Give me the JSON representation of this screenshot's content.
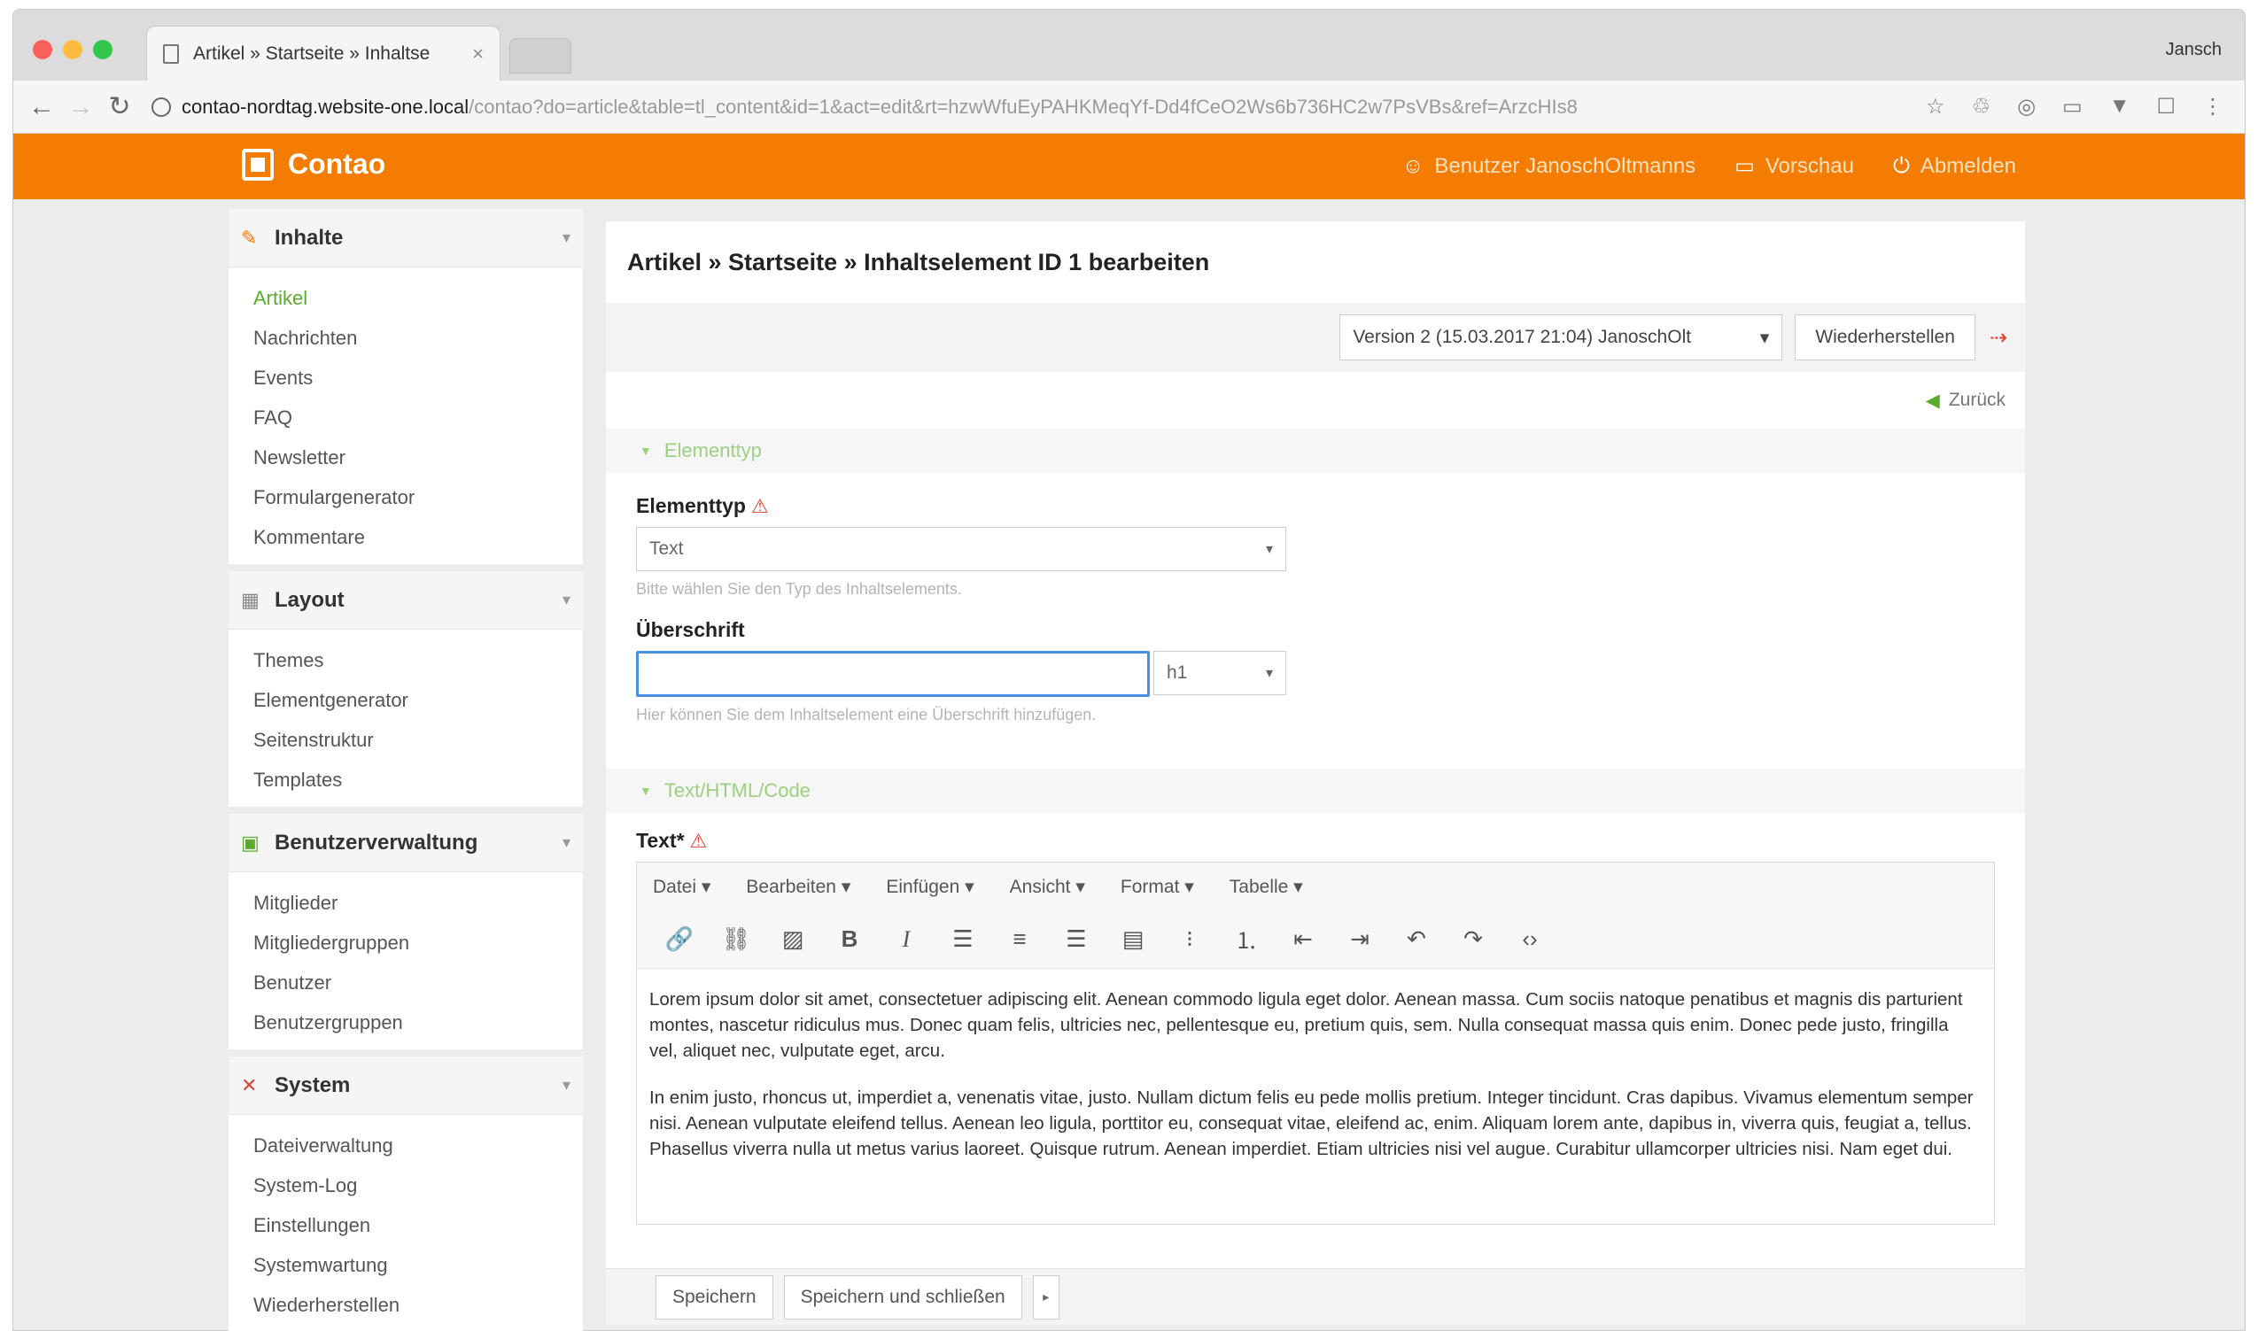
{
  "browser": {
    "tab_title": "Artikel » Startseite » Inhaltse",
    "tab_close": "×",
    "profile_name": "Jansch",
    "url_host": "contao-nordtag.website-one.local",
    "url_path": "/contao?do=article&table=tl_content&id=1&act=edit&rt=hzwWfuEyPAHKMeqYf-Dd4fCeO2Ws6b736HC2w7PsVBs&ref=ArzcHIs8",
    "back": "←",
    "forward": "→",
    "reload": "↻",
    "ext_icons": [
      "☆",
      "♲",
      "◎",
      "▭",
      "▼",
      "☐",
      "⋮"
    ]
  },
  "header": {
    "brand": "Contao",
    "nav": [
      {
        "icon": "☺",
        "icon_name": "user-icon",
        "label": "Benutzer JanoschOltmanns"
      },
      {
        "icon": "▭",
        "icon_name": "preview-icon",
        "label": "Vorschau"
      },
      {
        "icon": "⏻",
        "icon_name": "logout-icon",
        "label": "Abmelden"
      }
    ]
  },
  "sidebar": {
    "groups": [
      {
        "name": "Inhalte",
        "icon": "✎",
        "icon_name": "pencil-icon",
        "icon_class": "",
        "toggle": "▾",
        "items": [
          "Artikel",
          "Nachrichten",
          "Events",
          "FAQ",
          "Newsletter",
          "Formulargenerator",
          "Kommentare"
        ]
      },
      {
        "name": "Layout",
        "icon": "▦",
        "icon_name": "layout-icon",
        "icon_class": "",
        "toggle": "▾",
        "items": [
          "Themes",
          "Elementgenerator",
          "Seitenstruktur",
          "Templates"
        ]
      },
      {
        "name": "Benutzerverwaltung",
        "icon": "▣",
        "icon_name": "users-icon",
        "icon_class": "green",
        "toggle": "▾",
        "items": [
          "Mitglieder",
          "Mitgliedergruppen",
          "Benutzer",
          "Benutzergruppen"
        ]
      },
      {
        "name": "System",
        "icon": "✕",
        "icon_name": "tools-icon",
        "icon_class": "red",
        "toggle": "▾",
        "items": [
          "Dateiverwaltung",
          "System-Log",
          "Einstellungen",
          "Systemwartung",
          "Wiederherstellen"
        ]
      }
    ],
    "active_item": "Artikel"
  },
  "main": {
    "title": "Artikel » Startseite » Inhaltselement ID 1 bearbeiten",
    "version_select": "Version 2 (15.03.2017 21:04) JanoschOlt",
    "version_caret": "▾",
    "restore_label": "Wiederherstellen",
    "diff_icon": "⇢",
    "back_arrow": "◀",
    "back_label": "Zurück",
    "legend_arrow": "▼",
    "section_type": "Elementtyp",
    "field_type_label": "Elementtyp",
    "field_type_value": "Text",
    "field_type_help": "Bitte wählen Sie den Typ des Inhaltselements.",
    "field_headline_label": "Überschrift",
    "field_headline_value": "",
    "field_headline_level": "h1",
    "field_headline_help": "Hier können Sie dem Inhaltselement eine Überschrift hinzufügen.",
    "section_text": "Text/HTML/Code",
    "field_text_label": "Text*",
    "warn": "⚠",
    "caret": "▾"
  },
  "editor": {
    "menus": [
      "Datei ▾",
      "Bearbeiten ▾",
      "Einfügen ▾",
      "Ansicht ▾",
      "Format ▾",
      "Tabelle ▾"
    ],
    "tools": [
      {
        "glyph": "🔗",
        "name": "link-icon"
      },
      {
        "glyph": "⛓",
        "name": "unlink-icon"
      },
      {
        "glyph": "▨",
        "name": "image-icon"
      },
      {
        "glyph": "B",
        "name": "bold-icon"
      },
      {
        "glyph": "I",
        "name": "italic-icon"
      },
      {
        "glyph": "☰",
        "name": "align-left-icon"
      },
      {
        "glyph": "≡",
        "name": "align-center-icon"
      },
      {
        "glyph": "☰",
        "name": "align-right-icon"
      },
      {
        "glyph": "▤",
        "name": "align-justify-icon"
      },
      {
        "glyph": "⁝",
        "name": "bullet-list-icon"
      },
      {
        "glyph": "⒈",
        "name": "numbered-list-icon"
      },
      {
        "glyph": "⇤",
        "name": "outdent-icon"
      },
      {
        "glyph": "⇥",
        "name": "indent-icon"
      },
      {
        "glyph": "↶",
        "name": "undo-icon"
      },
      {
        "glyph": "↷",
        "name": "redo-icon"
      },
      {
        "glyph": "‹›",
        "name": "code-icon"
      }
    ],
    "paragraphs": [
      "Lorem ipsum dolor sit amet, consectetuer adipiscing elit. Aenean commodo ligula eget dolor. Aenean massa. Cum sociis natoque penatibus et magnis dis parturient montes, nascetur ridiculus mus. Donec quam felis, ultricies nec, pellentesque eu, pretium quis, sem. Nulla consequat massa quis enim. Donec pede justo, fringilla vel, aliquet nec, vulputate eget, arcu.",
      "In enim justo, rhoncus ut, imperdiet a, venenatis vitae, justo. Nullam dictum felis eu pede mollis pretium. Integer tincidunt. Cras dapibus. Vivamus elementum semper nisi. Aenean vulputate eleifend tellus. Aenean leo ligula, porttitor eu, consequat vitae, eleifend ac, enim. Aliquam lorem ante, dapibus in, viverra quis, feugiat a, tellus. Phasellus viverra nulla ut metus varius laoreet. Quisque rutrum. Aenean imperdiet. Etiam ultricies nisi vel augue. Curabitur ullamcorper ultricies nisi. Nam eget dui."
    ]
  },
  "savebar": {
    "save": "Speichern",
    "save_close": "Speichern und schließen",
    "more": "▸"
  }
}
